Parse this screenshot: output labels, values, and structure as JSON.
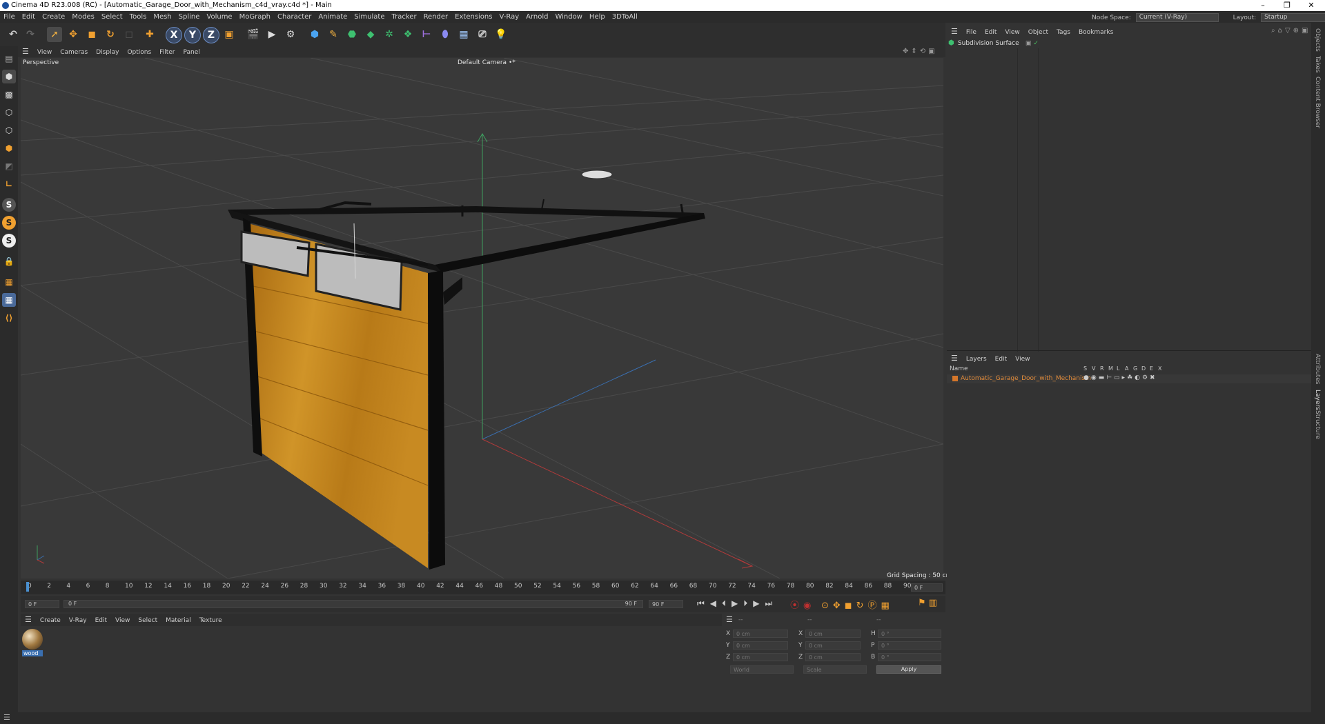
{
  "window": {
    "title": "Cinema 4D R23.008 (RC) - [Automatic_Garage_Door_with_Mechanism_c4d_vray.c4d *] - Main",
    "minimize": "–",
    "maximize": "❐",
    "close": "✕"
  },
  "menubar": {
    "items": [
      "File",
      "Edit",
      "Create",
      "Modes",
      "Select",
      "Tools",
      "Mesh",
      "Spline",
      "Volume",
      "MoGraph",
      "Character",
      "Animate",
      "Simulate",
      "Tracker",
      "Render",
      "Extensions",
      "V-Ray",
      "Arnold",
      "Window",
      "Help",
      "3DToAll"
    ],
    "node_space_label": "Node Space:",
    "node_space_value": "Current (V-Ray)",
    "layout_label": "Layout:",
    "layout_value": "Startup"
  },
  "toolbar": {
    "axis_x": "X",
    "axis_y": "Y",
    "axis_z": "Z"
  },
  "lefttools": {
    "s1": "S",
    "s2": "S",
    "s3": "S"
  },
  "viewport": {
    "menu": [
      "View",
      "Cameras",
      "Display",
      "Options",
      "Filter",
      "Panel"
    ],
    "name": "Perspective",
    "camera": "Default Camera",
    "camera_suffix": "•*",
    "grid_spacing": "Grid Spacing : 50 cm"
  },
  "timeline": {
    "ticks": [
      "0",
      "2",
      "4",
      "6",
      "8",
      "10",
      "12",
      "14",
      "16",
      "18",
      "20",
      "22",
      "24",
      "26",
      "28",
      "30",
      "32",
      "34",
      "36",
      "38",
      "40",
      "42",
      "44",
      "46",
      "48",
      "50",
      "52",
      "54",
      "56",
      "58",
      "60",
      "62",
      "64",
      "66",
      "68",
      "70",
      "72",
      "74",
      "76",
      "78",
      "80",
      "82",
      "84",
      "86",
      "88",
      "90"
    ],
    "current_frame_right": "0 F",
    "start_frame": "0 F",
    "min_frame": "0 F",
    "max_frame": "90 F",
    "end_frame": "90 F"
  },
  "material_panel": {
    "menu": [
      "Create",
      "V-Ray",
      "Edit",
      "View",
      "Select",
      "Material",
      "Texture"
    ],
    "material_name": "wood"
  },
  "coords": {
    "header_left": "--",
    "header_mid": "--",
    "header_right": "--",
    "x_label": "X",
    "y_label": "Y",
    "z_label": "Z",
    "x2_label": "X",
    "y2_label": "Y",
    "z2_label": "Z",
    "h_label": "H",
    "p_label": "P",
    "b_label": "B",
    "x_value": "0 cm",
    "y_value": "0 cm",
    "z_value": "0 cm",
    "x2_value": "0 cm",
    "y2_value": "0 cm",
    "z2_value": "0 cm",
    "h_value": "0 °",
    "p_value": "0 °",
    "b_value": "0 °",
    "space_select": "World",
    "mode_select": "Scale",
    "apply_label": "Apply"
  },
  "objects_panel": {
    "menu": [
      "File",
      "Edit",
      "View",
      "Object",
      "Tags",
      "Bookmarks"
    ],
    "objects": [
      {
        "name": "Subdivision Surface"
      }
    ]
  },
  "layers_panel": {
    "menu": [
      "Layers",
      "Edit",
      "View"
    ],
    "col_name": "Name",
    "flags": [
      "S",
      "V",
      "R",
      "M",
      "L",
      "A",
      "G",
      "D",
      "E",
      "X"
    ],
    "layers": [
      {
        "name": "Automatic_Garage_Door_with_Mechanism",
        "color": "#d4762a"
      }
    ]
  },
  "side_tabs": [
    "Objects",
    "Takes",
    "Content Browser",
    "Attributes",
    "Layers",
    "Structure"
  ],
  "colors": {
    "accent_blue": "#3f8fd8",
    "orange": "#e8932a",
    "wood": "#c8861e"
  }
}
